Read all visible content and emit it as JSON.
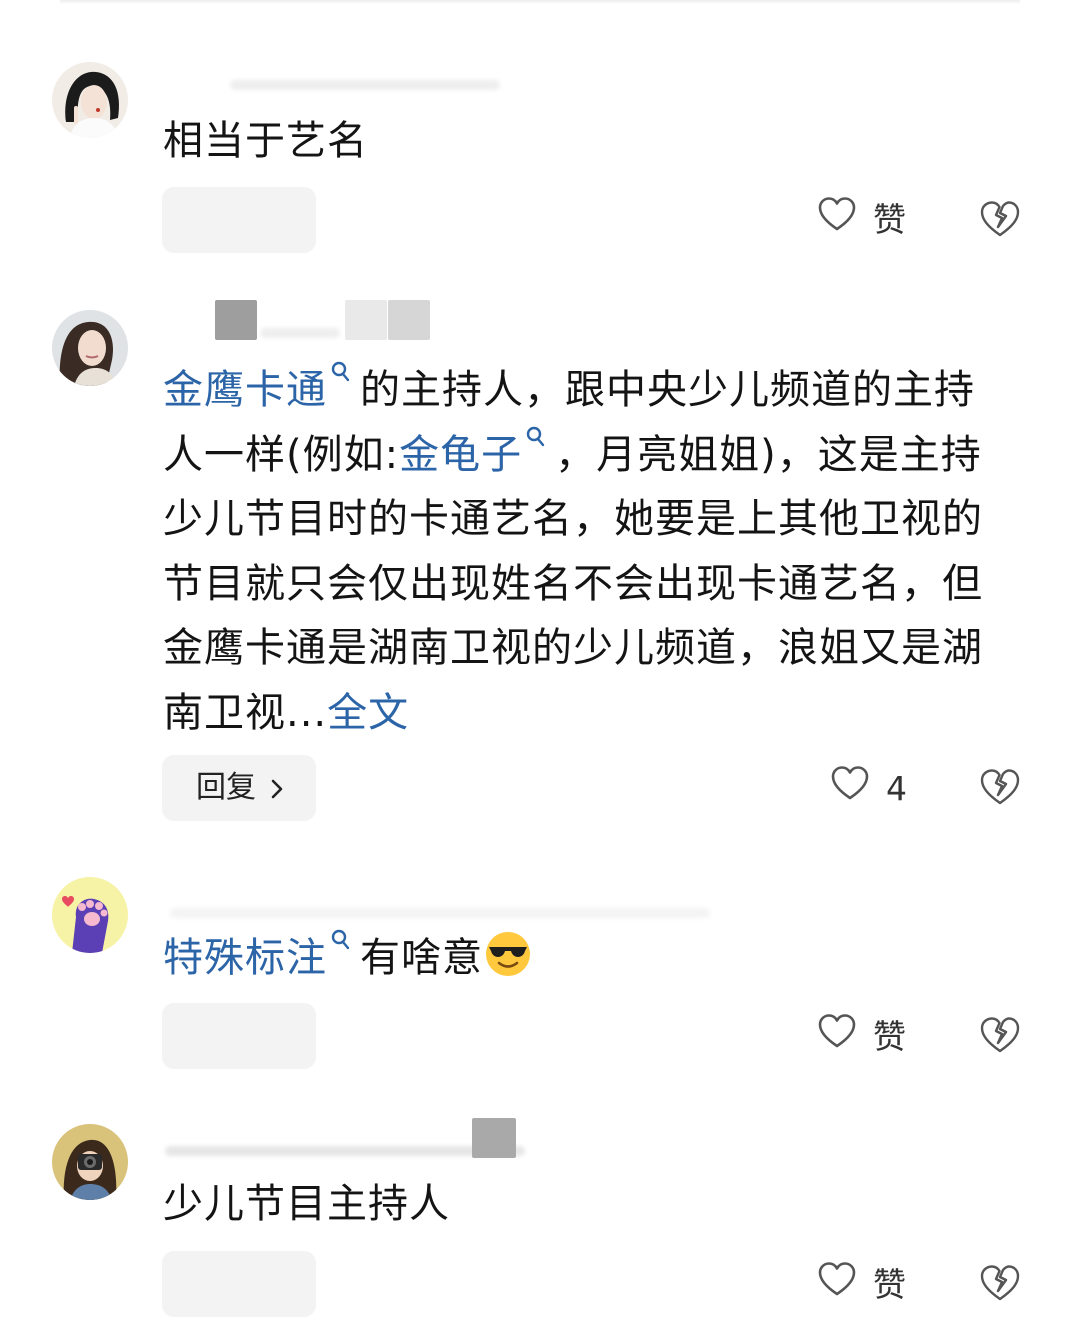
{
  "comments": [
    {
      "text": "相当于艺名",
      "reply_label": "",
      "like_label": "赞"
    },
    {
      "topic_1": "金鹰卡通",
      "text_1": "的主持人，跟中央少儿频道的主持人一样(例如:",
      "topic_2": "金龟子",
      "text_2": "，月亮姐姐)，这是主持少儿节目时的卡通艺名，她要是上其他卫视的节目就只会仅出现姓名不会出现卡通艺名，但金鹰卡通是湖南卫视的少儿频道，浪姐又是湖南卫视...",
      "more_label": "全文",
      "reply_label": "回复",
      "like_label": "4"
    },
    {
      "topic_1": "特殊标注",
      "text_1": "有啥意",
      "reply_label": "",
      "like_label": "赞"
    },
    {
      "text": "少儿节目主持人",
      "reply_label": "",
      "like_label": "赞"
    }
  ],
  "icons": {
    "like": "heart-outline-icon",
    "dislike": "broken-heart-icon",
    "topic": "search-icon",
    "reply_chevron": "chevron-right-icon",
    "emoji": "sunglasses-emoji-icon"
  },
  "colors": {
    "link": "#2c64a8",
    "text": "#141414",
    "button_bg": "#f3f3f4",
    "icon": "#555555"
  }
}
